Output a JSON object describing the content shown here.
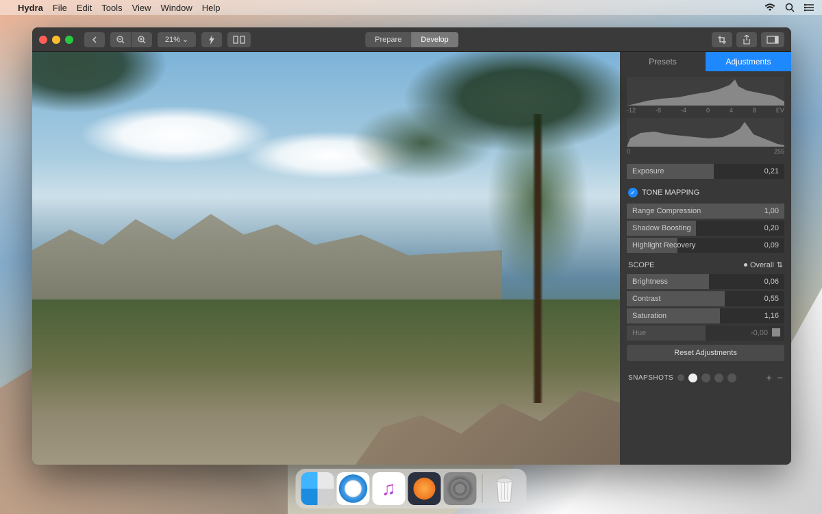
{
  "menubar": {
    "app_name": "Hydra",
    "items": [
      "File",
      "Edit",
      "Tools",
      "View",
      "Window",
      "Help"
    ]
  },
  "toolbar": {
    "zoom_label": "21% ⌄",
    "seg_prepare": "Prepare",
    "seg_develop": "Develop"
  },
  "panel": {
    "tab_presets": "Presets",
    "tab_adjustments": "Adjustments",
    "ev_ticks": [
      "-12",
      "-8",
      "-4",
      "0",
      "4",
      "8",
      "EV"
    ],
    "lum_ticks": [
      "0",
      "255"
    ],
    "exposure": {
      "label": "Exposure",
      "value": "0,21",
      "fill": 55
    },
    "tone_mapping_hdr": "TONE MAPPING",
    "range_compression": {
      "label": "Range Compression",
      "value": "1,00",
      "fill": 100
    },
    "shadow_boosting": {
      "label": "Shadow Boosting",
      "value": "0,20",
      "fill": 44
    },
    "highlight_recovery": {
      "label": "Highlight Recovery",
      "value": "0,09",
      "fill": 32
    },
    "scope_hdr": "SCOPE",
    "scope_value": "Overall",
    "brightness": {
      "label": "Brightness",
      "value": "0,06",
      "fill": 52
    },
    "contrast": {
      "label": "Contrast",
      "value": "0,55",
      "fill": 62
    },
    "saturation": {
      "label": "Saturation",
      "value": "1,16",
      "fill": 59
    },
    "hue": {
      "label": "Hue",
      "value": "-0,00",
      "fill": 50
    },
    "reset_label": "Reset Adjustments",
    "snapshots_hdr": "SNAPSHOTS"
  },
  "dock": {
    "items": [
      "finder",
      "safari",
      "music",
      "hydra",
      "sysprefs",
      "trash"
    ]
  }
}
